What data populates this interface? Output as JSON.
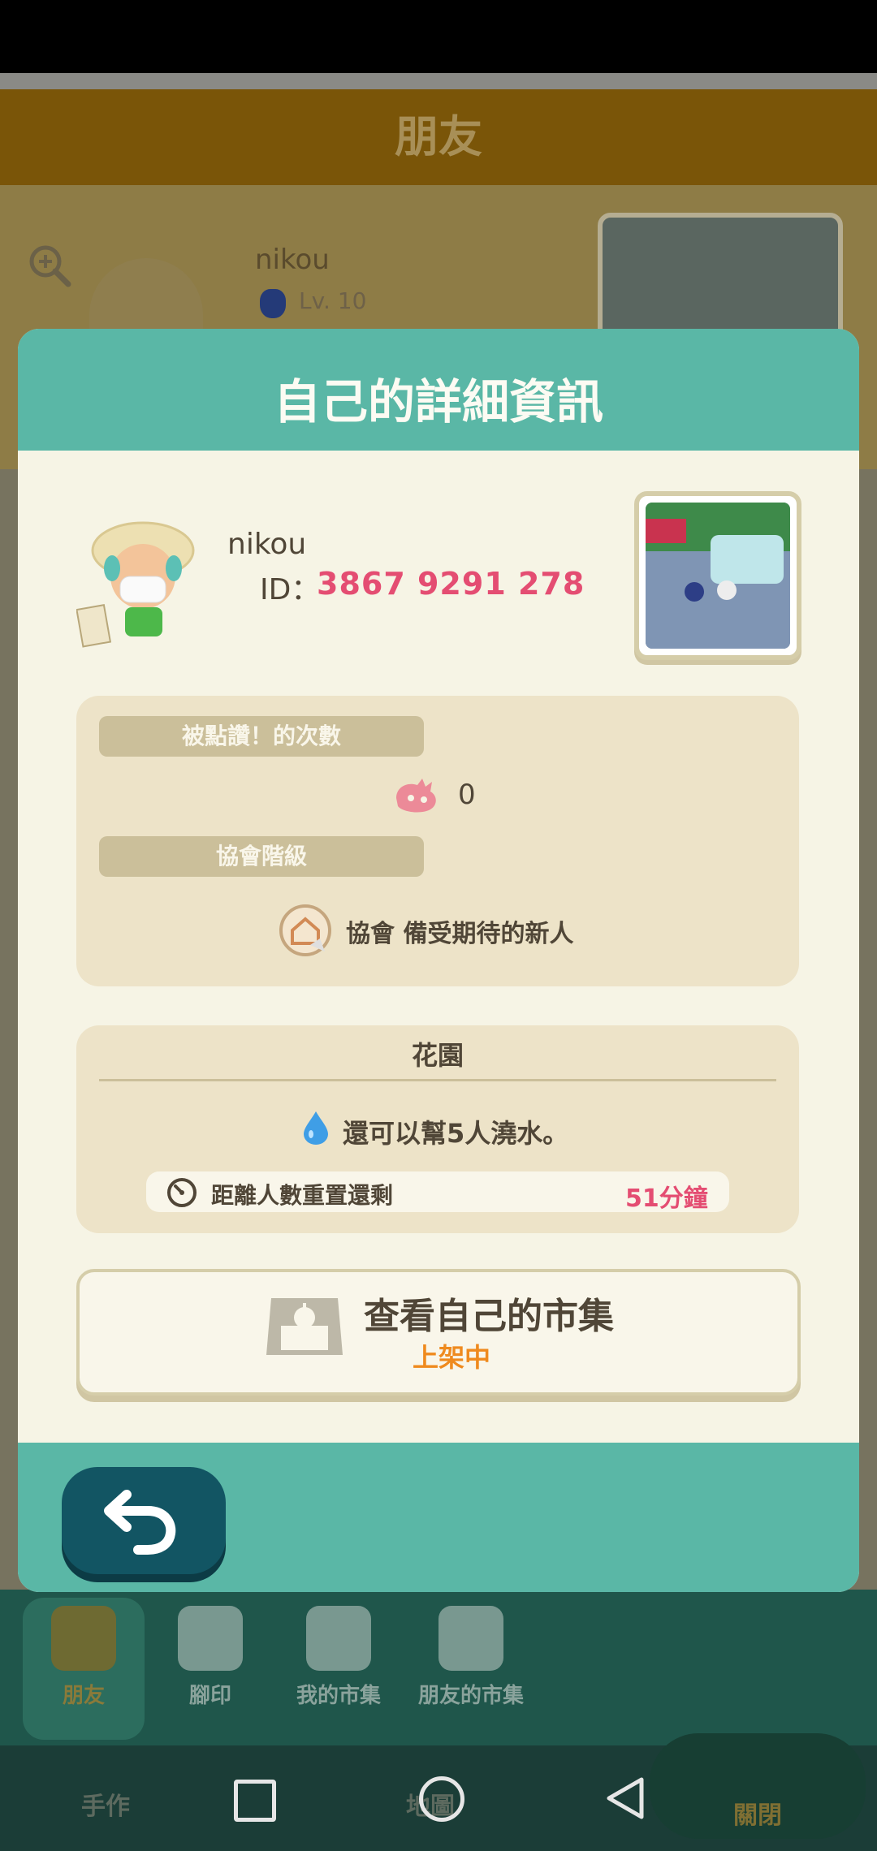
{
  "background": {
    "header_title": "朋友",
    "friend_name": "nikou",
    "friend_level": "Lv. 10",
    "tabs": [
      {
        "label": "朋友",
        "icon": "friends-icon"
      },
      {
        "label": "腳印",
        "icon": "footprints-icon"
      },
      {
        "label": "我的市集",
        "icon": "market-icon"
      },
      {
        "label": "朋友的市集",
        "icon": "friends-market-icon"
      }
    ],
    "bottom_craft": "手作",
    "bottom_map": "地圖",
    "bottom_close": "關閉"
  },
  "modal": {
    "title": "自己的詳細資訊",
    "profile": {
      "name": "nikou",
      "id_label": "ID：",
      "id_value": "3867 9291 278"
    },
    "stats": {
      "likes_label": "被點讚！的次數",
      "likes_value": "0",
      "rank_label": "協會階級",
      "rank_text": "協會 備受期待的新人"
    },
    "garden": {
      "title": "花園",
      "water_text": "還可以幫5人澆水。",
      "reset_label": "距離人數重置還剩",
      "reset_value": "51分鐘"
    },
    "market": {
      "title": "查看自己的市集",
      "status": "上架中"
    }
  },
  "colors": {
    "teal": "#5ab7a6",
    "panel": "#f6f4e5",
    "accent_pink": "#e44d72",
    "accent_orange": "#ef8a1e",
    "back_button": "#125563"
  }
}
